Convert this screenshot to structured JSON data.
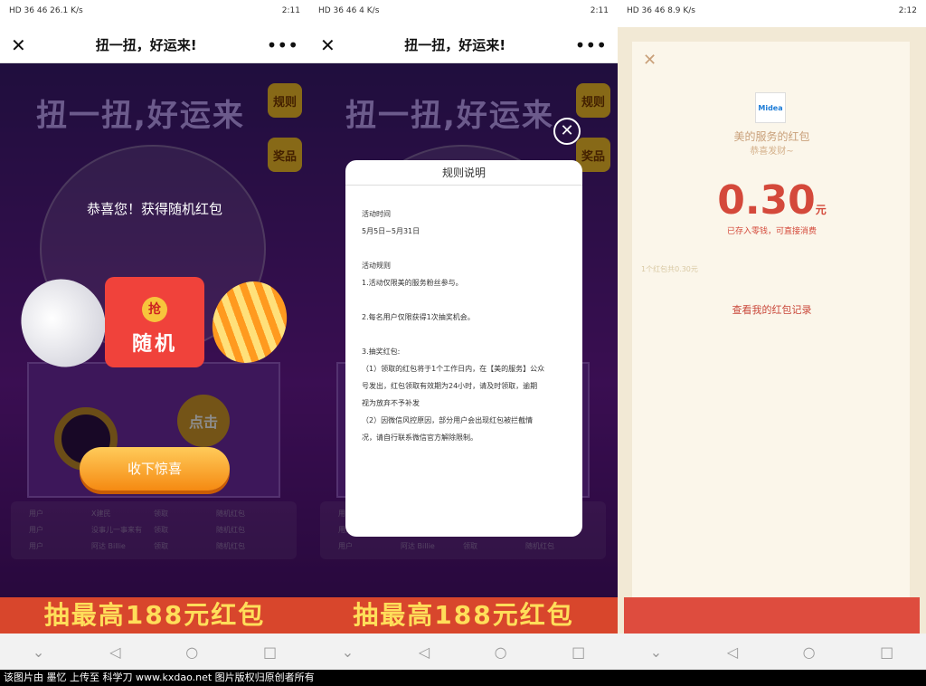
{
  "status": {
    "left": "HD 36 46 26.1 K/s",
    "mid_left": "HD 36 46 4 K/s",
    "right_left": "HD 36 46 8.9 K/s",
    "time1": "2:11",
    "time2": "2:11",
    "time3": "2:12"
  },
  "page_title": "扭一扭，好运来!",
  "game": {
    "title": "扭一扭,好运来",
    "rules_btn": "规则",
    "prize_btn": "奖品",
    "tap_btn": "点击",
    "banner": "抽最高188元红包",
    "winners": [
      "用户",
      "X建民",
      "领取",
      "随机红包",
      "用户",
      "没事儿一事来有",
      "领取",
      "随机红包",
      "用户",
      "阿达 Billie",
      "领取",
      "随机红包"
    ]
  },
  "result": {
    "congrats": "恭喜您！获得随机红包",
    "seal": "抢",
    "envelope": "随机",
    "accept": "收下惊喜"
  },
  "rules_modal": {
    "title": "规则说明",
    "lines": [
      "活动时间",
      "5月5日~5月31日",
      "",
      "活动规则",
      "1.活动仅限美的服务粉丝参与。",
      "",
      "2.每名用户仅限获得1次抽奖机会。",
      "",
      "3.抽奖红包:",
      "（1）领取的红包将于1个工作日内，在【美的服务】公众",
      "号发出，红包领取有效期为24小时，请及时领取，逾期",
      "视为放弃不予补发",
      "（2）因微信风控原因，部分用户会出现红包被拦截情",
      "况，请自行联系微信官方解除限制。"
    ]
  },
  "redpacket": {
    "logo": "Midea",
    "logo_sub": "美的服务",
    "from": "美的服务的红包",
    "wish": "恭喜发财~",
    "amount": "0.30",
    "unit": "元",
    "note": "已存入零钱，可直接消费",
    "count": "1个红包共0.30元",
    "history_link": "查看我的红包记录"
  },
  "footer": "该图片由 墨忆 上传至 科学刀 www.kxdao.net 图片版权归原创者所有"
}
